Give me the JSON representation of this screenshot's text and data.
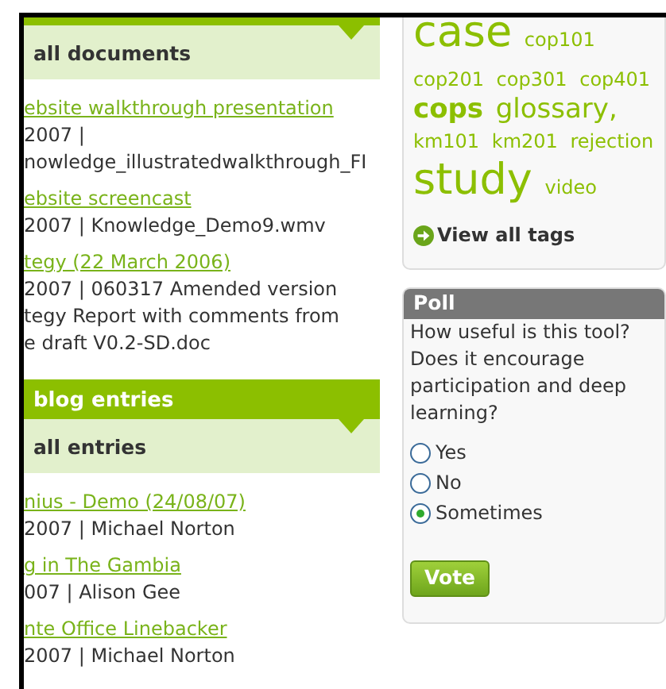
{
  "documents": {
    "heading": "all documents",
    "items": [
      {
        "title": "ebsite walkthrough presentation",
        "meta": [
          "2007 |",
          "nowledge_illustratedwalkthrough_FI"
        ]
      },
      {
        "title": "ebsite screencast",
        "meta": [
          "2007 | Knowledge_Demo9.wmv"
        ]
      },
      {
        "title": "tegy (22 March 2006)",
        "meta": [
          "2007 | 060317 Amended version",
          "tegy Report with comments from",
          "e draft V0.2-SD.doc"
        ]
      }
    ]
  },
  "blog": {
    "title": "blog entries",
    "heading": "all entries",
    "items": [
      {
        "title": "nius - Demo (24/08/07)",
        "meta": [
          "2007 | Michael Norton"
        ]
      },
      {
        "title": "g in The Gambia",
        "meta": [
          "007 | Alison Gee"
        ]
      },
      {
        "title": "nte Office Linebacker",
        "meta": [
          "2007 | Michael Norton"
        ]
      }
    ]
  },
  "tags": {
    "lines": [
      [
        {
          "label": "case",
          "kind": "huge"
        },
        {
          "label": "cop101",
          "kind": "small"
        }
      ],
      [
        {
          "label": "cop201",
          "kind": "small"
        },
        {
          "label": "cop301",
          "kind": "small"
        },
        {
          "label": "cop401",
          "kind": "small"
        }
      ],
      [
        {
          "label": "cops",
          "kind": "bold"
        },
        {
          "label": "glossary,",
          "kind": "big"
        }
      ],
      [
        {
          "label": "km101",
          "kind": "small"
        },
        {
          "label": "km201",
          "kind": "small"
        },
        {
          "label": "rejection",
          "kind": "small"
        }
      ],
      [
        {
          "label": "study",
          "kind": "huge"
        },
        {
          "label": "video",
          "kind": "small"
        }
      ]
    ],
    "view_all": "View all tags"
  },
  "poll": {
    "title": "Poll",
    "question": "How useful is this tool? Does it encourage participation and deep learning?",
    "options": [
      {
        "label": "Yes",
        "selected": false
      },
      {
        "label": "No",
        "selected": false
      },
      {
        "label": "Sometimes",
        "selected": true
      }
    ],
    "button": "Vote"
  }
}
